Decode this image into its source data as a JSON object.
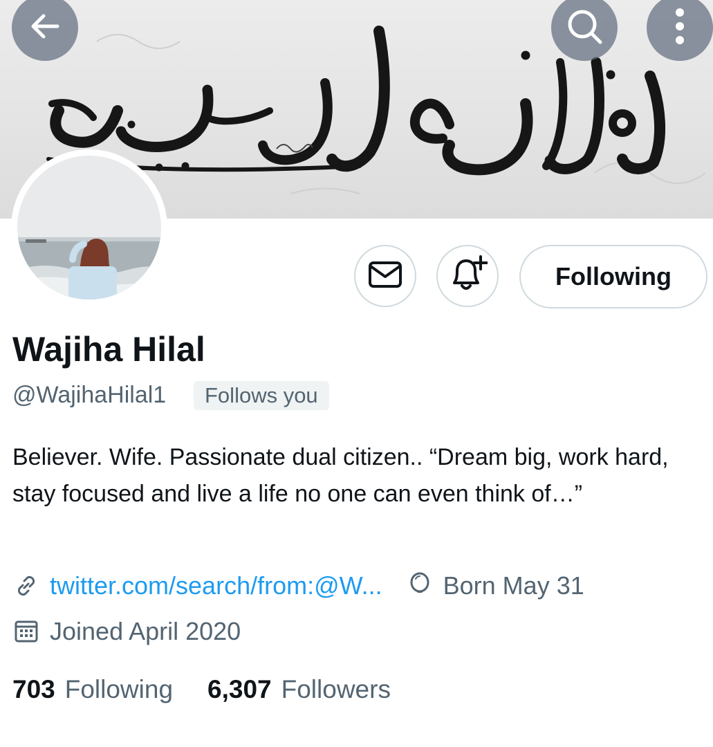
{
  "header": {
    "back_icon": "arrow-left-icon",
    "search_icon": "search-icon",
    "more_icon": "more-vertical-icon"
  },
  "profile": {
    "name": "Wajiha Hilal",
    "handle": "@WajihaHilal1",
    "follows_you": "Follows you",
    "bio": "Believer. Wife. Passionate dual citizen.. “Dream big, work hard, stay focused and live a life no one can even think of…”",
    "link": "twitter.com/search/from:@W...",
    "birthday": "Born May 31",
    "joined": "Joined April 2020"
  },
  "actions": {
    "message_icon": "envelope-icon",
    "notify_icon": "bell-plus-icon",
    "follow_label": "Following"
  },
  "stats": {
    "following_count": "703",
    "following_label": "Following",
    "followers_count": "6,307",
    "followers_label": "Followers"
  },
  "colors": {
    "link": "#1d9bf0",
    "secondary_text": "#536471",
    "primary_text": "#0f1419",
    "border": "#cfd9de"
  }
}
